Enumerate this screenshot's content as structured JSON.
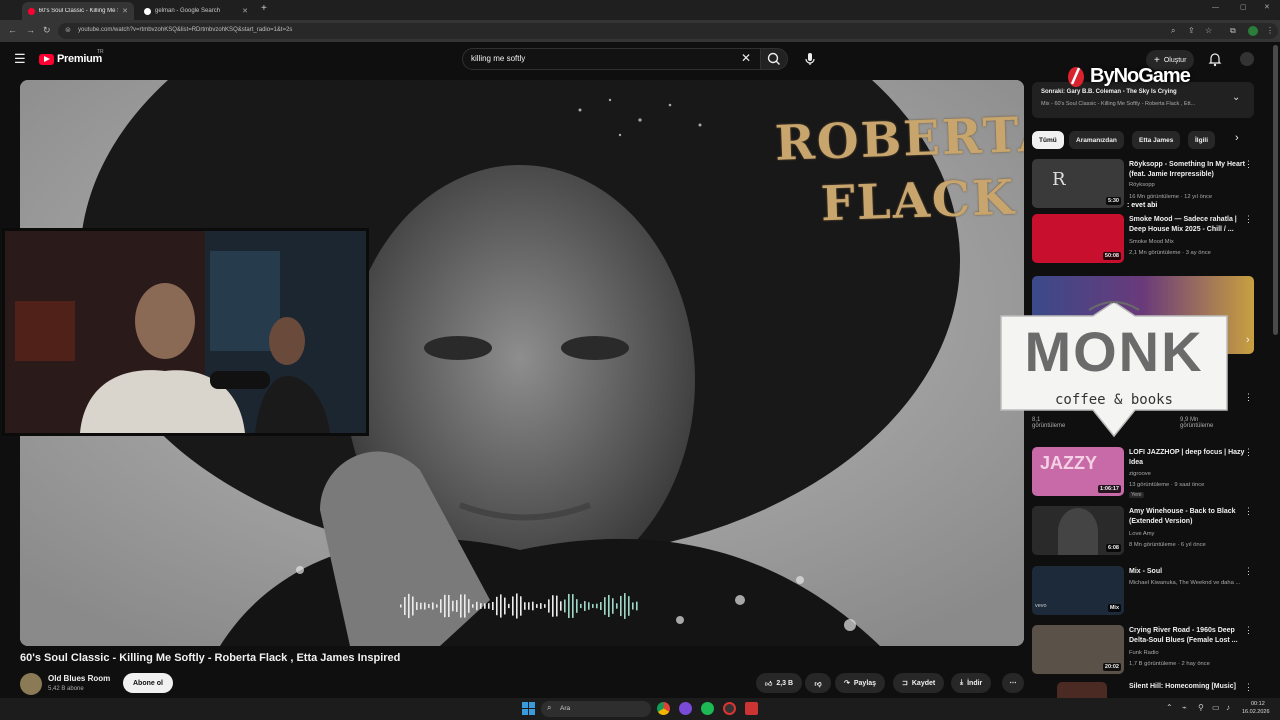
{
  "browser": {
    "tabs": [
      {
        "label": "60's Soul Classic - Killing Me So",
        "active": true
      },
      {
        "label": "gelman - Google Search",
        "active": false
      }
    ],
    "url": "youtube.com/watch?v=rtmbvzohKSQ&list=RDrtmbvzohKSQ&start_radio=1&t=2s"
  },
  "header": {
    "logo_text": "Premium",
    "logo_suffix": "TR",
    "search_value": "killing me softly",
    "create_label": "Oluştur"
  },
  "video": {
    "overlay_line1": "ROBERTA",
    "overlay_line2": "FLACK",
    "title": "60's Soul Classic - Killing Me Softly - Roberta Flack , Etta James Inspired",
    "channel": "Old Blues Room",
    "subscribers": "5,42 B abone",
    "subscribe_label": "Abone ol",
    "likes": "2,3 B",
    "share_label": "Paylaş",
    "save_label": "Kaydet",
    "download_label": "İndir"
  },
  "sidebar": {
    "up_next_title": "Sonraki: Gary B.B. Coleman - The Sky Is Crying",
    "up_next_sub": "Mix - 60's Soul Classic - Killing Me Softly - Roberta Flack , Ett...",
    "chips": [
      "Tümü",
      "Aramanızdan",
      "Etta James",
      "İlgili"
    ],
    "recs": [
      {
        "title": "Röyksopp - Something In My Heart (feat. Jamie Irrepressible)",
        "channel": "Röyksopp",
        "meta": "16 Mn görüntüleme · 12 yıl önce",
        "duration": "5:30",
        "overlay": ": evet abi",
        "thumb": "#3a3a3a"
      },
      {
        "title": "Smoke Mood — Sadece rahatla | Deep House Mix 2025 - Chill / ...",
        "channel": "Smoke Mood Mix",
        "meta": "2,1 Mn görüntüleme · 3 ay önce",
        "duration": "50:08",
        "thumb": "#c8102e"
      },
      {
        "title": "LOFI JAZZHOP | deep focus | Hazy Idea",
        "channel": "zigroove",
        "meta": "13 görüntüleme · 9 saat önce",
        "badge": "Yeni",
        "duration": "1:06:17",
        "thumb": "#c86aa8"
      },
      {
        "title": "Amy Winehouse - Back to Black (Extended Version)",
        "channel": "Love Amy",
        "meta": "8 Mn görüntüleme · 6 yıl önce",
        "duration": "6:08",
        "thumb": "#2a2a2a"
      },
      {
        "title": "Mix - Soul",
        "channel": "Michael Kiwanuka, The Weeknd ve daha ...",
        "meta": "",
        "duration": "Mix",
        "thumb": "#1d2a3a"
      },
      {
        "title": "Crying River Road - 1960s Deep Delta-Soul Blues (Female Lost ...",
        "channel": "Funk Radio",
        "meta": "1,7 B görüntüleme · 2 hay önce",
        "duration": "20:02",
        "thumb": "#5a5248"
      },
      {
        "title": "Silent Hill: Homecoming [Music]",
        "channel": "",
        "meta": "",
        "duration": "",
        "thumb": "#4a2a22"
      }
    ],
    "partial_views_left": "8,1",
    "partial_views_label": "görüntüleme",
    "partial_views_right": "9,9 Mn"
  },
  "overlays": {
    "sponsor1": "ByNoGame",
    "sponsor2_main": "MONK",
    "sponsor2_sub": "coffee & books"
  },
  "taskbar": {
    "search_placeholder": "Ara",
    "time": "00:12",
    "date": "16.02.2026"
  }
}
